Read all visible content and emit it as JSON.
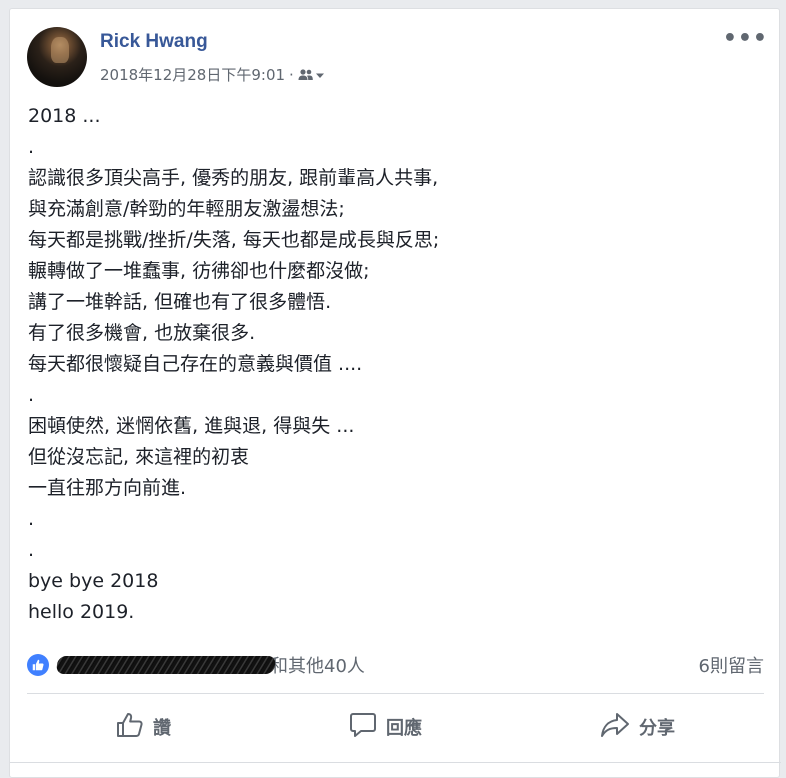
{
  "post": {
    "author": "Rick Hwang",
    "timestamp": "2018年12月28日下午9:01",
    "separator": "·",
    "audience_icon": "friends-icon",
    "more_label": "•••",
    "lines": [
      "2018 ...",
      ".",
      "認識很多頂尖高手, 優秀的朋友, 跟前輩高人共事,",
      "與充滿創意/幹勁的年輕朋友激盪想法;",
      "每天都是挑戰/挫折/失落, 每天也都是成長與反思;",
      "輾轉做了一堆蠢事, 彷彿卻也什麼都沒做;",
      "講了一堆幹話, 但確也有了很多體悟.",
      "有了很多機會, 也放棄很多.",
      "每天都很懷疑自己存在的意義與價值 ....",
      ".",
      "困頓使然, 迷惘依舊, 進與退, 得與失 ...",
      "但從沒忘記, 來這裡的初衷",
      "一直往那方向前進.",
      ".",
      ".",
      "bye bye 2018",
      "hello 2019."
    ]
  },
  "reactions": {
    "suffix": "和其他40人",
    "comments": "6則留言"
  },
  "actions": {
    "like": "讚",
    "comment": "回應",
    "share": "分享"
  },
  "colors": {
    "link": "#385898",
    "like_blue": "#4080ff",
    "muted": "#606770"
  }
}
